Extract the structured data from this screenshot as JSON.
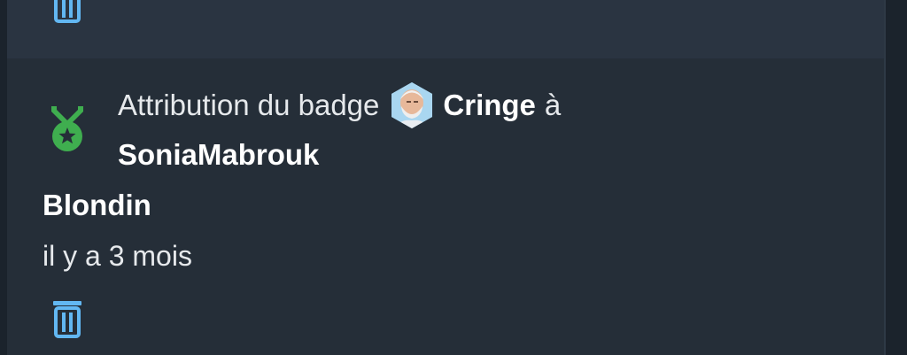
{
  "notification": {
    "prefix": "Attribution du badge",
    "badge_name": "Cringe",
    "connector": "à",
    "recipient": "SoniaMabrouk",
    "granted_by": "Blondin",
    "time_ago": "il y a 3 mois",
    "icons": {
      "badge": "medal-star-icon",
      "avatar": "badge-avatar-image",
      "delete": "trash-icon"
    }
  },
  "colors": {
    "background": "#1f2731",
    "card": "#252e38",
    "previous_card": "#2a3441",
    "text": "#e6e9ec",
    "medal_green": "#3fae4f",
    "trash_blue": "#62b7f2"
  }
}
